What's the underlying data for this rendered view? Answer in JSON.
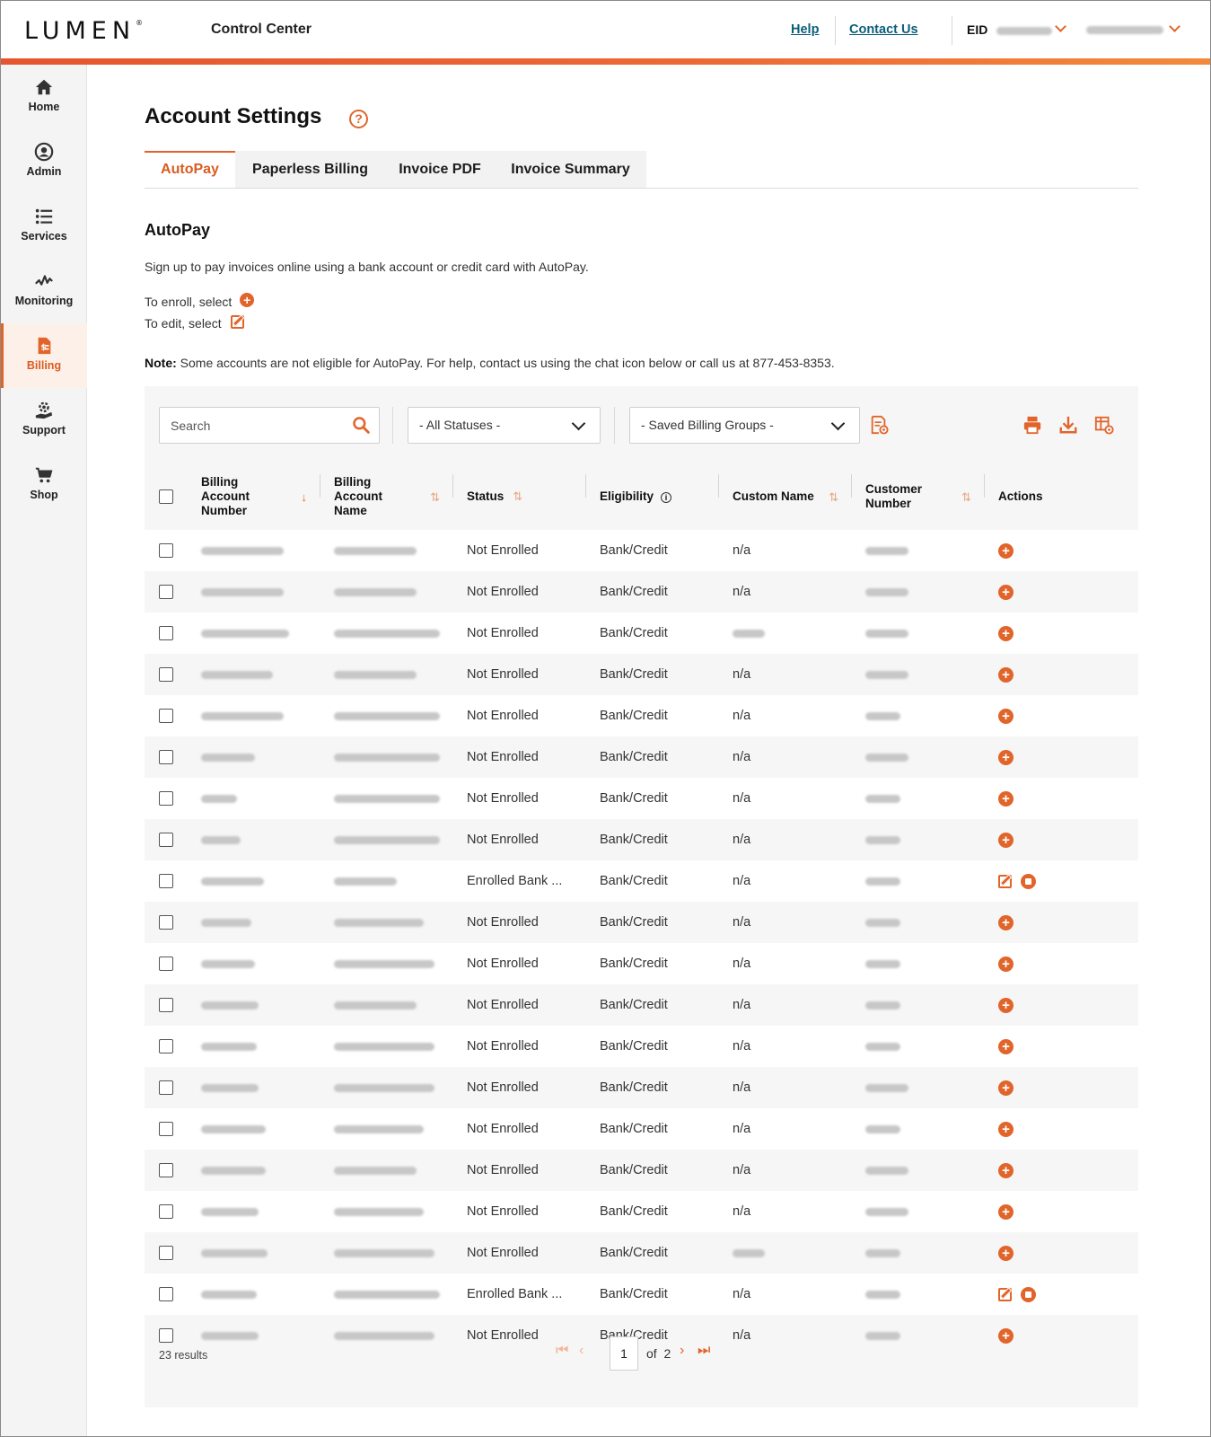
{
  "header": {
    "logo": "LUMEN",
    "logo_mark": "®",
    "app_title": "Control Center",
    "help": "Help",
    "contact": "Contact Us",
    "eid_label": "EID"
  },
  "sidebar": {
    "items": [
      {
        "label": "Home",
        "icon": "home-icon"
      },
      {
        "label": "Admin",
        "icon": "user-circle-icon"
      },
      {
        "label": "Services",
        "icon": "list-icon"
      },
      {
        "label": "Monitoring",
        "icon": "pulse-icon"
      },
      {
        "label": "Billing",
        "icon": "billing-doc-icon",
        "active": true
      },
      {
        "label": "Support",
        "icon": "support-hand-icon"
      },
      {
        "label": "Shop",
        "icon": "cart-icon"
      }
    ]
  },
  "page": {
    "title": "Account Settings",
    "help_glyph": "?"
  },
  "tabs": [
    {
      "label": "AutoPay",
      "active": true
    },
    {
      "label": "Paperless Billing"
    },
    {
      "label": "Invoice PDF"
    },
    {
      "label": "Invoice Summary"
    }
  ],
  "autopay": {
    "title": "AutoPay",
    "intro": "Sign up to pay invoices online using a bank account or credit card with AutoPay.",
    "enroll": "To enroll, select",
    "edit": "To edit, select",
    "note_label": "Note:",
    "note_text": " Some accounts are not eligible for AutoPay. For help, contact us using the chat icon below or call us at 877-453-8353."
  },
  "toolbar": {
    "search_placeholder": "Search",
    "status_filter": "- All Statuses -",
    "groups_filter": "- Saved Billing Groups -"
  },
  "table": {
    "columns": [
      {
        "label": "Billing Account Number",
        "sort": "down"
      },
      {
        "label": "Billing Account Name",
        "sort": "both"
      },
      {
        "label": "Status",
        "sort": "both"
      },
      {
        "label": "Eligibility",
        "info": true
      },
      {
        "label": "Custom Name",
        "sort": "both"
      },
      {
        "label": "Customer Number",
        "sort": "both"
      },
      {
        "label": "Actions"
      }
    ],
    "rows": [
      {
        "status": "Not Enrolled",
        "eligibility": "Bank/Credit",
        "custom_name": "n/a",
        "actions": "add"
      },
      {
        "status": "Not Enrolled",
        "eligibility": "Bank/Credit",
        "custom_name": "n/a",
        "actions": "add"
      },
      {
        "status": "Not Enrolled",
        "eligibility": "Bank/Credit",
        "custom_name": "",
        "actions": "add"
      },
      {
        "status": "Not Enrolled",
        "eligibility": "Bank/Credit",
        "custom_name": "n/a",
        "actions": "add"
      },
      {
        "status": "Not Enrolled",
        "eligibility": "Bank/Credit",
        "custom_name": "n/a",
        "actions": "add"
      },
      {
        "status": "Not Enrolled",
        "eligibility": "Bank/Credit",
        "custom_name": "n/a",
        "actions": "add"
      },
      {
        "status": "Not Enrolled",
        "eligibility": "Bank/Credit",
        "custom_name": "n/a",
        "actions": "add"
      },
      {
        "status": "Not Enrolled",
        "eligibility": "Bank/Credit",
        "custom_name": "n/a",
        "actions": "add"
      },
      {
        "status": "Enrolled Bank ...",
        "eligibility": "Bank/Credit",
        "custom_name": "n/a",
        "actions": "edit"
      },
      {
        "status": "Not Enrolled",
        "eligibility": "Bank/Credit",
        "custom_name": "n/a",
        "actions": "add"
      },
      {
        "status": "Not Enrolled",
        "eligibility": "Bank/Credit",
        "custom_name": "n/a",
        "actions": "add"
      },
      {
        "status": "Not Enrolled",
        "eligibility": "Bank/Credit",
        "custom_name": "n/a",
        "actions": "add"
      },
      {
        "status": "Not Enrolled",
        "eligibility": "Bank/Credit",
        "custom_name": "n/a",
        "actions": "add"
      },
      {
        "status": "Not Enrolled",
        "eligibility": "Bank/Credit",
        "custom_name": "n/a",
        "actions": "add"
      },
      {
        "status": "Not Enrolled",
        "eligibility": "Bank/Credit",
        "custom_name": "n/a",
        "actions": "add"
      },
      {
        "status": "Not Enrolled",
        "eligibility": "Bank/Credit",
        "custom_name": "n/a",
        "actions": "add"
      },
      {
        "status": "Not Enrolled",
        "eligibility": "Bank/Credit",
        "custom_name": "n/a",
        "actions": "add"
      },
      {
        "status": "Not Enrolled",
        "eligibility": "Bank/Credit",
        "custom_name": "",
        "actions": "add"
      },
      {
        "status": "Enrolled Bank ...",
        "eligibility": "Bank/Credit",
        "custom_name": "n/a",
        "actions": "edit"
      },
      {
        "status": "Not Enrolled",
        "eligibility": "Bank/Credit",
        "custom_name": "n/a",
        "actions": "add"
      }
    ]
  },
  "pagination": {
    "results": "23 results",
    "current_page": "1",
    "of_label": "of",
    "total_pages": "2"
  },
  "colors": {
    "accent": "#e1652b",
    "link": "#0c5e7a"
  }
}
